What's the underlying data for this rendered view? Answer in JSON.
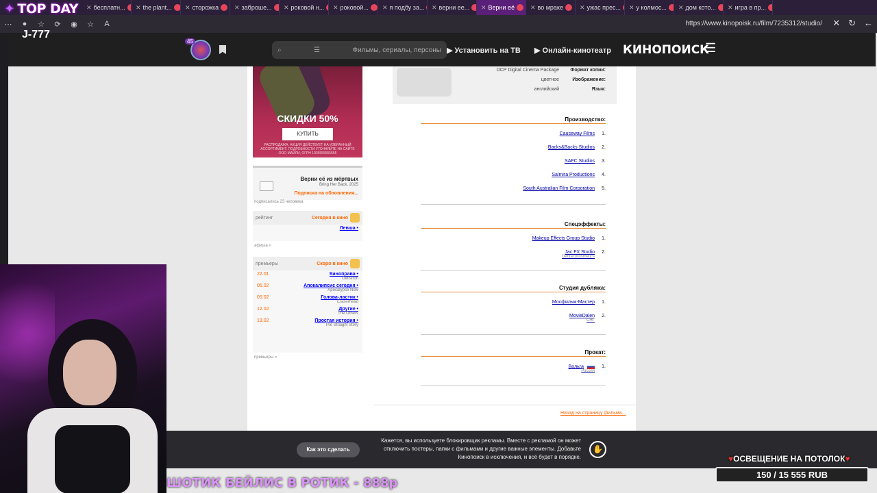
{
  "overlay": {
    "title": "TOP DAY",
    "stub": "J-777",
    "ticker": "ШОТИК БЕЙЛИС В РОТИК - 888р",
    "ceiling_label": "ОСВЕЩЕНИЕ НА ПОТОЛОК",
    "goal": "150 / 15 555 RUB"
  },
  "browser": {
    "tabs": [
      "бесплатн...",
      "the plant...",
      "сторожка",
      "заброше...",
      "роковой н...",
      "роковой...",
      "я подбу за...",
      "верни ее...",
      "Верни её",
      "во мраке",
      "ужас прес...",
      "у колмос...",
      "дом кото...",
      "игра в пр..."
    ],
    "url": "https://www.kinopoisk.ru/film/7235312/studio/"
  },
  "site": {
    "logo": "КИНОПОИСК",
    "nav_online": "Онлайн-кинотеатр",
    "nav_tv": "Установить на ТВ",
    "search_placeholder": "Фильмы, сериалы, персоны",
    "avatar_badge": "45"
  },
  "sidebar": {
    "promo_sale": "СКИДКИ 50%",
    "promo_buy": "КУПИТЬ",
    "promo_fine": "РАСПРОДАЖА. АКЦИЯ ДЕЙСТВУЕТ НА ИЗБРАННЫЙ АССОРТИМЕНТ. ПОДРОБНОСТИ УТОЧНЯЙТЕ НА САЙТЕ ООО МАЙЛИ, ОГРН 1035555555555",
    "sub_title": "Верни её из мёртвых",
    "sub_orig": "Bring Her Back, 2025",
    "sub_action": "Подписка на обновления...",
    "sub_count": "подписались 23 человека",
    "today_head": "Сегодня в кино",
    "today_right": "рейтинг",
    "today_items": [
      {
        "title": "Левша"
      }
    ],
    "today_more": "афиша »",
    "soon_head": "Скоро в кино",
    "soon_right": "премьеры",
    "soon_items": [
      {
        "title": "Киноправа",
        "orig": "Oldfshon",
        "date": "22.01"
      },
      {
        "title": "Апокалипсис сегодня",
        "orig": "Apocalypse Now",
        "date": "05.02"
      },
      {
        "title": "Голова-ластик",
        "orig": "Eraserhead",
        "date": "05.02"
      },
      {
        "title": "Другие",
        "orig": "The Others",
        "date": "12.02"
      },
      {
        "title": "Простая история",
        "orig": "The Straight Story",
        "date": "19.02"
      }
    ],
    "soon_more": "премьеры »"
  },
  "tech": [
    {
      "key": "Формат копии:",
      "value": "DCP Digital Cinema Package"
    },
    {
      "key": "Изображение:",
      "value": "цветное"
    },
    {
      "key": "Язык:",
      "value": "английский"
    }
  ],
  "sections": [
    {
      "title": "Производство:",
      "items": [
        {
          "num": "1.",
          "name": "Causeway Films",
          "note": ""
        },
        {
          "num": "2.",
          "name": "Backs&Backs Studios",
          "note": ""
        },
        {
          "num": "3.",
          "name": "SAFC Studios",
          "note": ""
        },
        {
          "num": "4.",
          "name": "Salmira Productions",
          "note": ""
        },
        {
          "num": "5.",
          "name": "South Australian Film Corporation",
          "note": ""
        }
      ]
    },
    {
      "title": "Спецэффекты:",
      "items": [
        {
          "num": "1.",
          "name": "Makeup Effects Group Studio",
          "note": ""
        },
        {
          "num": "2.",
          "name": "Jac FX Studio",
          "note": "Dental prosthetics"
        }
      ]
    },
    {
      "title": "Студия дубляжа:",
      "items": [
        {
          "num": "1.",
          "name": "Мосфильм-Мастер",
          "note": ""
        },
        {
          "num": "2.",
          "name": "MovieDalen",
          "note": "СНГ"
        }
      ]
    },
    {
      "title": "Прокат:",
      "items": [
        {
          "num": "1.",
          "name": "Вольга",
          "note": "Россия",
          "flag": true
        }
      ]
    }
  ],
  "back_link": "Назад на страницу фильма...",
  "adblock": {
    "message": "Кажется, вы используете блокировщик рекламы. Вместе с рекламой он может отключить постеры, папки с фильмами и другие важные элементы. Добавьте Кинопоиск в исключения, и всё будет в порядке.",
    "button": "Как это сделать"
  }
}
